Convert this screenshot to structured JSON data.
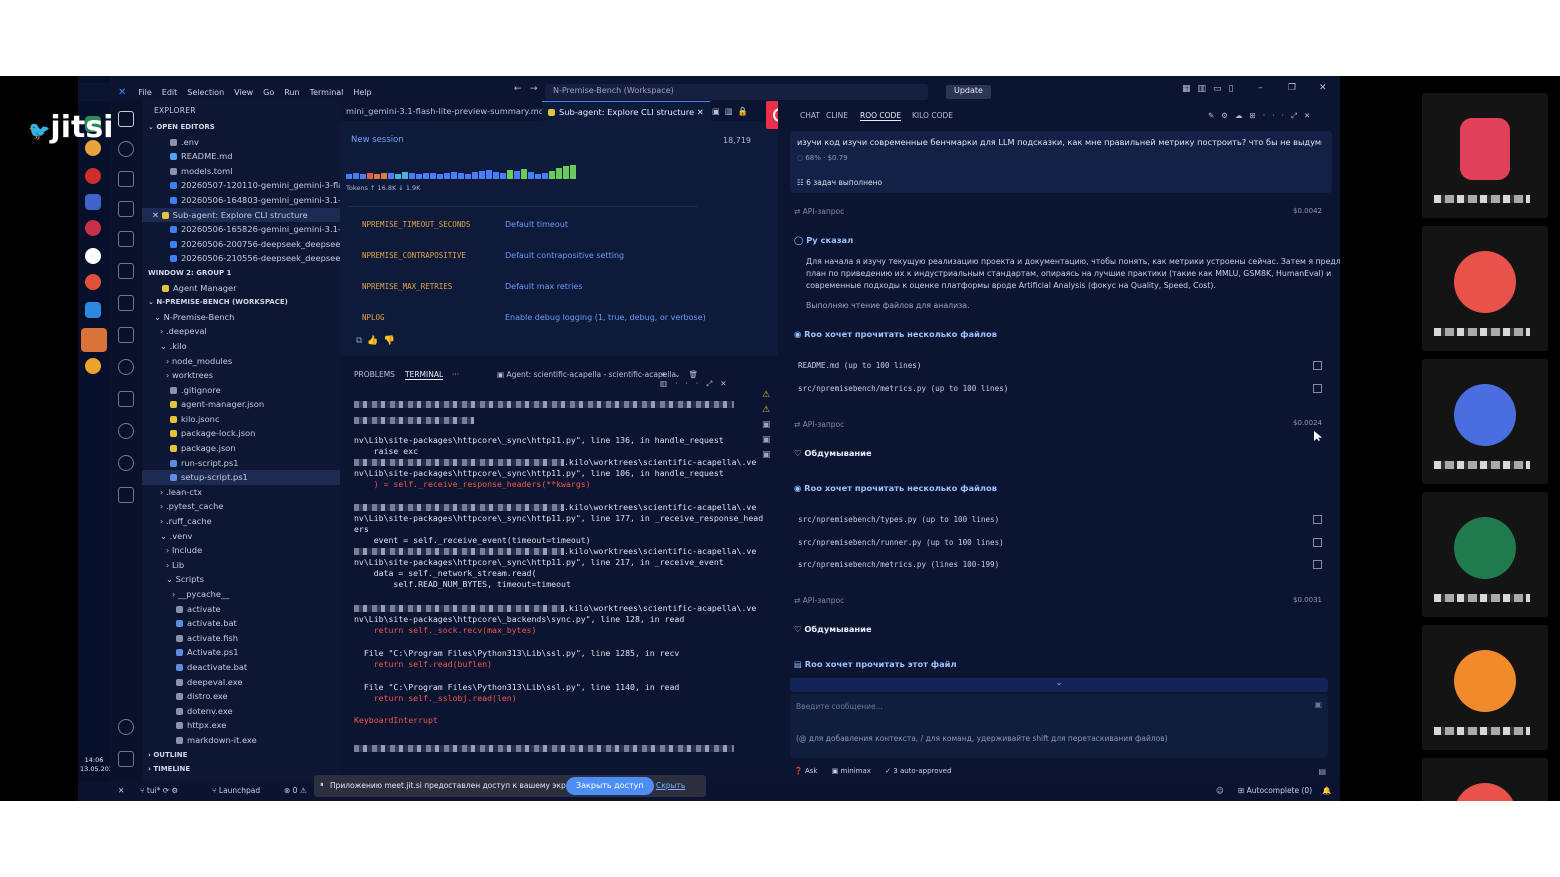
{
  "app": {
    "logo_text": "jitsi"
  },
  "menu": [
    "File",
    "Edit",
    "Selection",
    "View",
    "Go",
    "Run",
    "Terminal",
    "Help"
  ],
  "title": {
    "workspace": "N-Premise-Bench (Workspace)",
    "update": "Update"
  },
  "explorer": {
    "header": "EXPLORER",
    "open_editors": "OPEN EDITORS",
    "items": [
      ".env",
      "README.md",
      "models.toml",
      "20260507-120110-gemini_gemini-3-flash...",
      "20260506-164803-gemini_gemini-3.1-fla...",
      "Sub-agent: Explore CLI structure",
      "20260506-165826-gemini_gemini-3.1-pro...",
      "20260506-200756-deepseek_deepseek-v...",
      "20260506-210556-deepseek_deepseek-v..."
    ],
    "group2": "WINDOW 2: GROUP 1",
    "agent_manager": "Agent Manager",
    "workspace": "N-PREMISE-BENCH (WORKSPACE)",
    "tree": [
      "N-Premise-Bench",
      ".deepeval",
      ".kilo",
      "node_modules",
      "worktrees",
      ".gitignore",
      "agent-manager.json",
      "kilo.jsonc",
      "package-lock.json",
      "package.json",
      "run-script.ps1",
      "setup-script.ps1",
      ".lean-ctx",
      ".pytest_cache",
      ".ruff_cache",
      ".venv",
      "Include",
      "Lib",
      "Scripts",
      "__pycache__",
      "activate",
      "activate.bat",
      "activate.fish",
      "Activate.ps1",
      "deactivate.bat",
      "deepeval.exe",
      "distro.exe",
      "dotenv.exe",
      "httpx.exe",
      "markdown-it.exe"
    ],
    "outline": "OUTLINE",
    "timeline": "TIMELINE"
  },
  "editor": {
    "tab1": "mini_gemini-3.1-flash-lite-preview-summary.md",
    "tab2": "Sub-agent: Explore CLI structure",
    "session": "New session",
    "count": "18,719",
    "tokens_label": "Tokens",
    "tokens_up": "16.8K",
    "tokens_down": "1.9K",
    "env": [
      {
        "k": "NPREMISE_TIMEOUT_SECONDS",
        "v": "Default timeout"
      },
      {
        "k": "NPREMISE_CONTRAPOSITIVE",
        "v": "Default contrapositive setting"
      },
      {
        "k": "NPREMISE_MAX_RETRIES",
        "v": "Default max retries"
      },
      {
        "k": "NPLOG",
        "v": "Enable debug logging (1, true, debug, or verbose)"
      }
    ]
  },
  "panel": {
    "problems": "PROBLEMS",
    "terminal": "TERMINAL",
    "agent": "Agent: scientific-acapella - scientific-acapella",
    "lines": [
      "nv\\Lib\\site-packages\\httpcore\\_sync\\http11.py\", line 136, in handle_request",
      "    raise exc",
      ".kilo\\worktrees\\scientific-acapella\\.ve",
      "nv\\Lib\\site-packages\\httpcore\\_sync\\http11.py\", line 106, in handle_request",
      "    ) = self._receive_response_headers(**kwargs)",
      ".kilo\\worktrees\\scientific-acapella\\.ve",
      "nv\\Lib\\site-packages\\httpcore\\_sync\\http11.py\", line 177, in _receive_response_head",
      "ers",
      "    event = self._receive_event(timeout=timeout)",
      ".kilo\\worktrees\\scientific-acapella\\.ve",
      "nv\\Lib\\site-packages\\httpcore\\_sync\\http11.py\", line 217, in _receive_event",
      "    data = self._network_stream.read(",
      "        self.READ_NUM_BYTES, timeout=timeout",
      ".kilo\\worktrees\\scientific-acapella\\.ve",
      "nv\\Lib\\site-packages\\httpcore\\_backends\\sync.py\", line 128, in read",
      "    return self._sock.recv(max_bytes)",
      "  File \"C:\\Program Files\\Python313\\Lib\\ssl.py\", line 1285, in recv",
      "    return self.read(buflen)",
      "  File \"C:\\Program Files\\Python313\\Lib\\ssl.py\", line 1140, in read",
      "    return self._sslobj.read(len)",
      "KeyboardInterrupt"
    ]
  },
  "chat": {
    "tabs": [
      "CHAT",
      "CLINE",
      "ROO CODE",
      "KILO CODE"
    ],
    "prompt": "изучи код изучи современные бенчмарки для LLM подсказки, как мне правильней метрику построить? что бы не выдумывать ка",
    "progress": "68%",
    "cost": "$0.79",
    "tasks_done": "6 задач выполнено",
    "api": "API-запрос",
    "price1": "$0.0042",
    "roo_said": "Ру сказал",
    "roo_text1": "Для начала я изучу текущую реализацию проекта и документацию, чтобы понять, как метрики устроены сейчас. Затем я предложу",
    "roo_text2": "план по приведению их к индустриальным стандартам, опираясь на лучшие практики (такие как MMLU, GSM8K, HumanEval) и",
    "roo_text3": "современные подходы к оценке платформы вроде Artificial Analysis (фокус на Quality, Speed, Cost).",
    "roo_text4": "Выполняю чтение файлов для анализа.",
    "read_many": "Roo хочет прочитать несколько файлов",
    "files1": [
      "README.md (up to 100 lines)",
      "src/npremisebench/metrics.py (up to 100 lines)"
    ],
    "price2": "$0.0024",
    "thinking": "Обдумывание",
    "files2": [
      "src/npremisebench/types.py (up to 100 lines)",
      "src/npremisebench/runner.py (up to 100 lines)",
      "src/npremisebench/metrics.py (lines 100-199)"
    ],
    "price3": "$0.0031",
    "read_one": "Roo хочет прочитать этот файл",
    "input_placeholder": "Введите сообщение...",
    "input_hint": "(@ для добавления контекста, / для команд, удерживайте shift для перетаскивания файлов)",
    "mode": "Ask",
    "model": "minimax",
    "auto": "3 auto-approved"
  },
  "status": {
    "branch": "tui*",
    "launchpad": "Launchpad",
    "errors": "0",
    "autocomplete": "Autocomplete (0)",
    "clock_time": "14:06",
    "clock_date": "13.05.2026"
  },
  "share": {
    "text": "Приложению meet.jit.si предоставлен доступ к вашему экрану.",
    "stop": "Закрыть доступ",
    "hide": "Скрыть"
  },
  "colors": {
    "accent": "#4a7cff",
    "record": "#e8314a",
    "bg": "#0b1530"
  }
}
